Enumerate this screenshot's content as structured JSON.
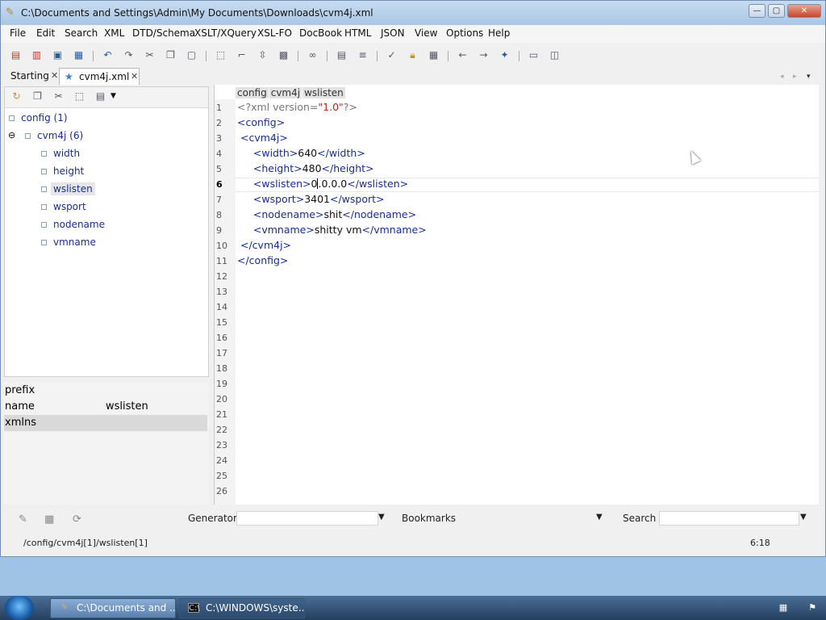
{
  "window": {
    "title": "C:\\Documents and Settings\\Admin\\My Documents\\Downloads\\cvm4j.xml",
    "minimize": "—",
    "maximize": "▢",
    "close": "✕"
  },
  "menu": [
    "File",
    "Edit",
    "Search",
    "XML",
    "DTD/Schema",
    "XSLT/XQuery",
    "XSL-FO",
    "DocBook",
    "HTML",
    "JSON",
    "View",
    "Options",
    "Help"
  ],
  "tabs": [
    {
      "label": "Starting",
      "close": "✕"
    },
    {
      "label": "cvm4j.xml",
      "close": "✕"
    }
  ],
  "tree": {
    "root": "config (1)",
    "child": "cvm4j (6)",
    "leaves": [
      "width",
      "height",
      "wslisten",
      "wsport",
      "nodename",
      "vmname"
    ]
  },
  "attributes": {
    "rows": [
      {
        "key": "prefix",
        "value": ""
      },
      {
        "key": "name",
        "value": "wslisten"
      },
      {
        "key": "xmlns",
        "value": ""
      }
    ]
  },
  "editor": {
    "breadcrumb": [
      "config",
      "cvm4j",
      "wslisten"
    ],
    "lines": [
      {
        "n": "1",
        "html": "pi",
        "parts": [
          [
            "pi",
            "<?xml version="
          ],
          [
            "val",
            "\"1.0\""
          ],
          [
            "pi",
            "?>"
          ]
        ]
      },
      {
        "n": "2",
        "parts": [
          [
            "tag",
            "<config>"
          ]
        ]
      },
      {
        "n": "3",
        "parts": [
          [
            "txt",
            " "
          ],
          [
            "tag",
            "<cvm4j>"
          ]
        ]
      },
      {
        "n": "4",
        "parts": [
          [
            "txt",
            "     "
          ],
          [
            "tag",
            "<width>"
          ],
          [
            "txt",
            "640"
          ],
          [
            "tag",
            "</width>"
          ]
        ]
      },
      {
        "n": "5",
        "parts": [
          [
            "txt",
            "     "
          ],
          [
            "tag",
            "<height>"
          ],
          [
            "txt",
            "480"
          ],
          [
            "tag",
            "</height>"
          ]
        ]
      },
      {
        "n": "6",
        "parts": [
          [
            "txt",
            "     "
          ],
          [
            "tag",
            "<wslisten>"
          ],
          [
            "txt",
            "0"
          ],
          [
            "cursor",
            ""
          ],
          [
            "txt",
            ".0.0.0"
          ],
          [
            "tag",
            "</wslisten>"
          ]
        ]
      },
      {
        "n": "7",
        "parts": [
          [
            "txt",
            "     "
          ],
          [
            "tag",
            "<wsport>"
          ],
          [
            "txt",
            "3401"
          ],
          [
            "tag",
            "</wsport>"
          ]
        ]
      },
      {
        "n": "8",
        "parts": [
          [
            "txt",
            "     "
          ],
          [
            "tag",
            "<nodename>"
          ],
          [
            "txt",
            "shit"
          ],
          [
            "tag",
            "</nodename>"
          ]
        ]
      },
      {
        "n": "9",
        "parts": [
          [
            "txt",
            "     "
          ],
          [
            "tag",
            "<vmname>"
          ],
          [
            "txt",
            "shitty vm"
          ],
          [
            "tag",
            "</vmname>"
          ]
        ]
      },
      {
        "n": "10",
        "parts": [
          [
            "txt",
            " "
          ],
          [
            "tag",
            "</cvm4j>"
          ]
        ]
      },
      {
        "n": "11",
        "parts": [
          [
            "tag",
            "</config>"
          ]
        ]
      },
      {
        "n": "12",
        "parts": []
      },
      {
        "n": "13",
        "parts": []
      },
      {
        "n": "14",
        "parts": []
      },
      {
        "n": "15",
        "parts": []
      },
      {
        "n": "16",
        "parts": []
      },
      {
        "n": "17",
        "parts": []
      },
      {
        "n": "18",
        "parts": []
      },
      {
        "n": "19",
        "parts": []
      },
      {
        "n": "20",
        "parts": []
      },
      {
        "n": "21",
        "parts": []
      },
      {
        "n": "22",
        "parts": []
      },
      {
        "n": "23",
        "parts": []
      },
      {
        "n": "24",
        "parts": []
      },
      {
        "n": "25",
        "parts": []
      },
      {
        "n": "26",
        "parts": []
      }
    ],
    "current_line": "6"
  },
  "bottom": {
    "generator_label": "Generator",
    "bookmarks_label": "Bookmarks",
    "search_label": "Search"
  },
  "status": {
    "path": "/config/cvm4j[1]/wslisten[1]",
    "position": "6:18"
  },
  "taskbar": {
    "tasks": [
      {
        "label": "C:\\Documents and ...",
        "icon": "xml-editor-icon"
      },
      {
        "label": "C:\\WINDOWS\\syste...",
        "icon": "cmd-icon"
      }
    ]
  }
}
